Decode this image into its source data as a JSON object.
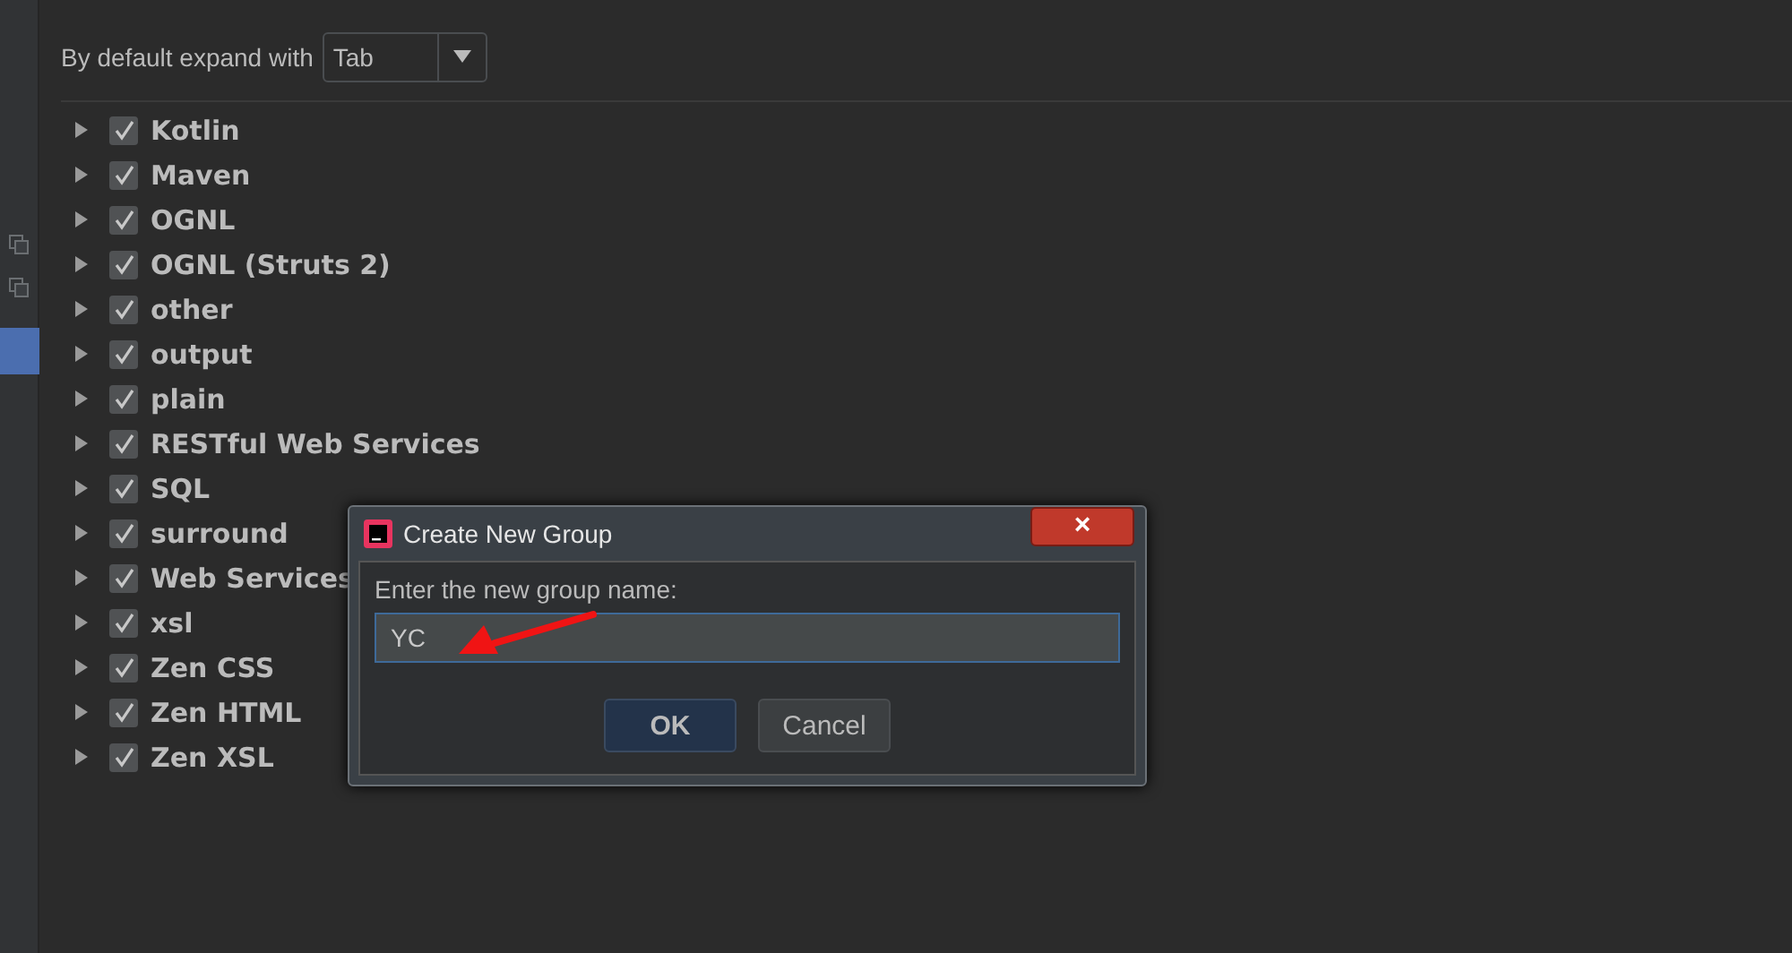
{
  "expand": {
    "label": "By default expand with",
    "value": "Tab"
  },
  "groups": [
    {
      "label": "Kotlin",
      "checked": true,
      "expanded": false
    },
    {
      "label": "Maven",
      "checked": true,
      "expanded": false
    },
    {
      "label": "OGNL",
      "checked": true,
      "expanded": false
    },
    {
      "label": "OGNL (Struts 2)",
      "checked": true,
      "expanded": false
    },
    {
      "label": "other",
      "checked": true,
      "expanded": false
    },
    {
      "label": "output",
      "checked": true,
      "expanded": false
    },
    {
      "label": "plain",
      "checked": true,
      "expanded": false
    },
    {
      "label": "RESTful Web Services",
      "checked": true,
      "expanded": false
    },
    {
      "label": "SQL",
      "checked": true,
      "expanded": false
    },
    {
      "label": "surround",
      "checked": true,
      "expanded": false
    },
    {
      "label": "Web Services",
      "checked": true,
      "expanded": false
    },
    {
      "label": "xsl",
      "checked": true,
      "expanded": false
    },
    {
      "label": "Zen CSS",
      "checked": true,
      "expanded": false
    },
    {
      "label": "Zen HTML",
      "checked": true,
      "expanded": false
    },
    {
      "label": "Zen XSL",
      "checked": true,
      "expanded": false
    }
  ],
  "dialog": {
    "title": "Create New Group",
    "close": "×",
    "prompt": "Enter the new group name:",
    "value": "YC",
    "buttons": [
      {
        "label": "OK",
        "default": true
      },
      {
        "label": "Cancel",
        "default": false
      }
    ]
  }
}
